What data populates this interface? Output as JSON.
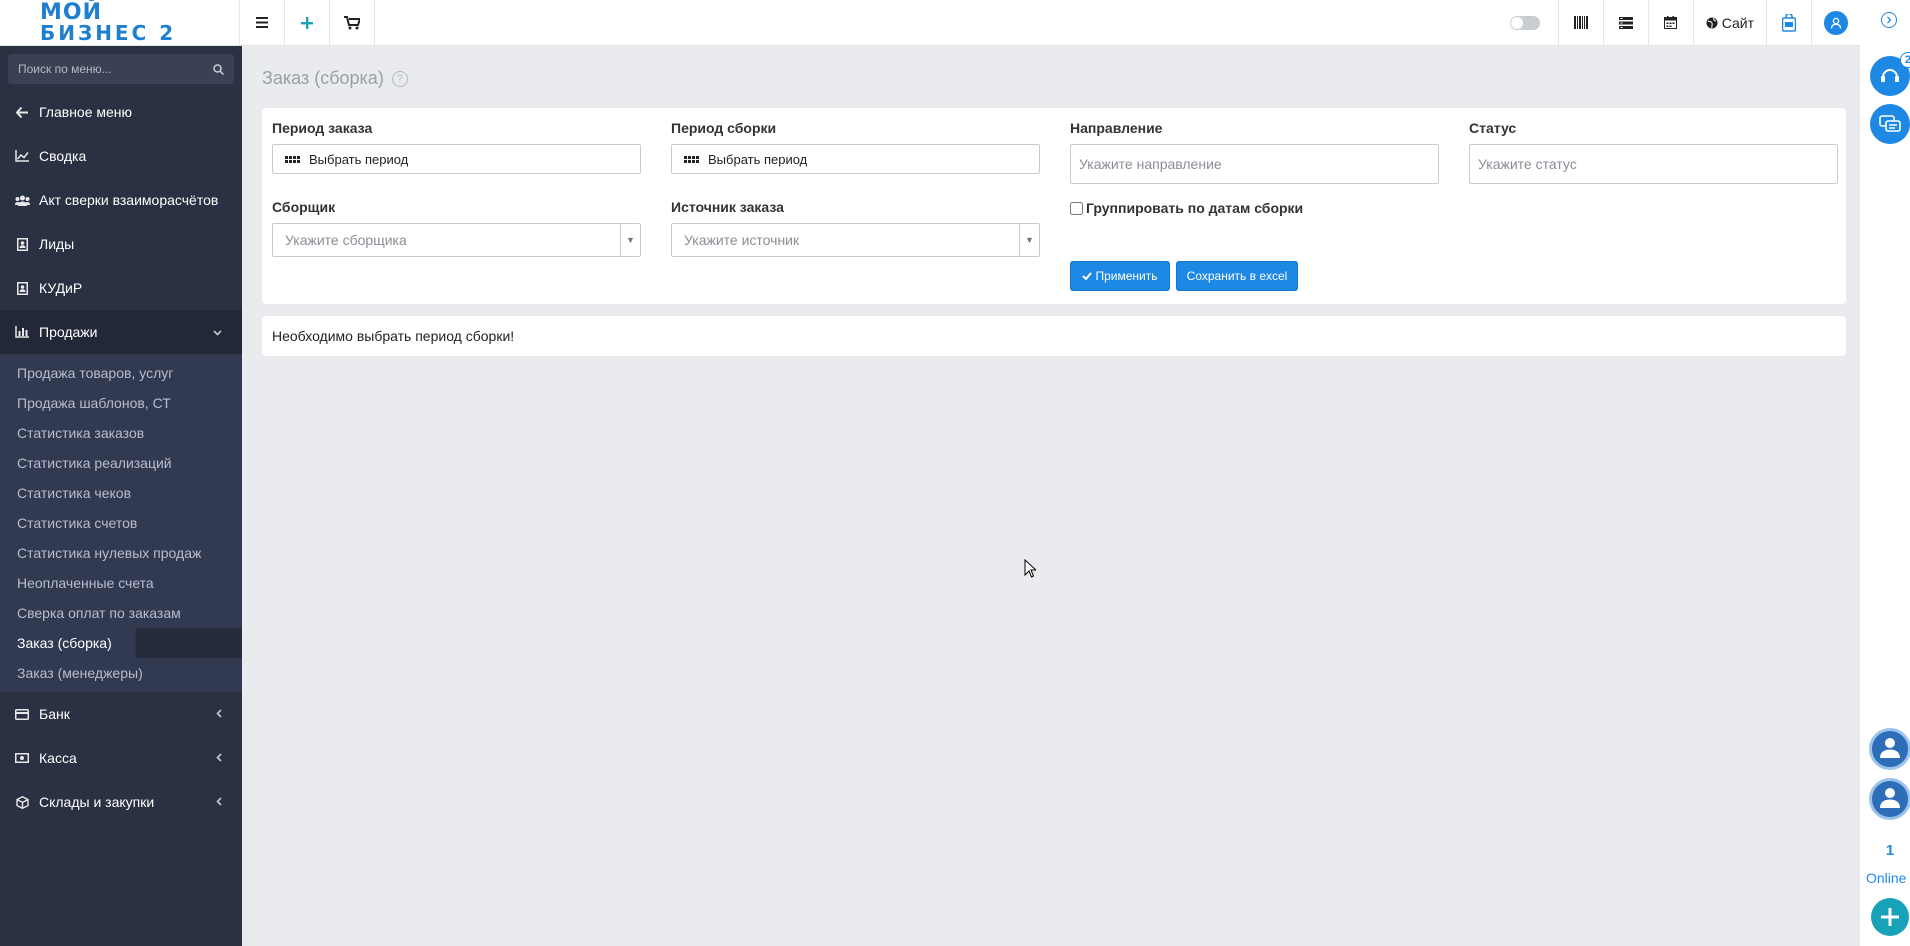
{
  "app": {
    "logo_line1": "МОЙ",
    "logo_line2": "БИЗНЕС 2",
    "site_label": "Сайт"
  },
  "sidebar": {
    "search_placeholder": "Поиск по меню...",
    "items": [
      {
        "label": "Главное меню",
        "icon": "arrow-left-icon"
      },
      {
        "label": "Сводка",
        "icon": "chart-line-icon"
      },
      {
        "label": "Акт сверки взаиморасчётов",
        "icon": "users-icon"
      },
      {
        "label": "Лиды",
        "icon": "contact-card-icon"
      },
      {
        "label": "КУДиР",
        "icon": "contact-card-icon"
      },
      {
        "label": "Продажи",
        "icon": "bar-chart-icon"
      },
      {
        "label": "Банк",
        "icon": "credit-card-icon"
      },
      {
        "label": "Касса",
        "icon": "money-icon"
      },
      {
        "label": "Склады и закупки",
        "icon": "cube-icon"
      }
    ],
    "sales_sub": [
      "Продажа товаров, услуг",
      "Продажа шаблонов, СТ",
      "Статистика заказов",
      "Статистика реализаций",
      "Статистика чеков",
      "Статистика счетов",
      "Статистика нулевых продаж",
      "Неоплаченные счета",
      "Сверка оплат по заказам",
      "Заказ (сборка)",
      "Заказ (менеджеры)"
    ]
  },
  "page": {
    "title": "Заказ (сборка)"
  },
  "filters": {
    "order_period_label": "Период заказа",
    "order_period_value": "Выбрать период",
    "assembly_period_label": "Период сборки",
    "assembly_period_value": "Выбрать период",
    "direction_label": "Направление",
    "direction_placeholder": "Укажите направление",
    "status_label": "Статус",
    "status_placeholder": "Укажите статус",
    "assembler_label": "Сборщик",
    "assembler_placeholder": "Укажите сборщика",
    "source_label": "Источник заказа",
    "source_placeholder": "Укажите источник",
    "group_by_label": "Группировать по датам сборки",
    "apply_label": "Применить",
    "excel_label": "Сохранить в excel"
  },
  "message": "Необходимо выбрать период сборки!",
  "rail": {
    "notifications_badge": "2",
    "online_count": "1",
    "online_label": "Online",
    "account_label": "My account"
  },
  "colors": {
    "sidebar_bg": "#2a3142",
    "submenu_bg": "#323a52",
    "accent": "#1e88e5",
    "page_bg": "#e9ebee"
  }
}
